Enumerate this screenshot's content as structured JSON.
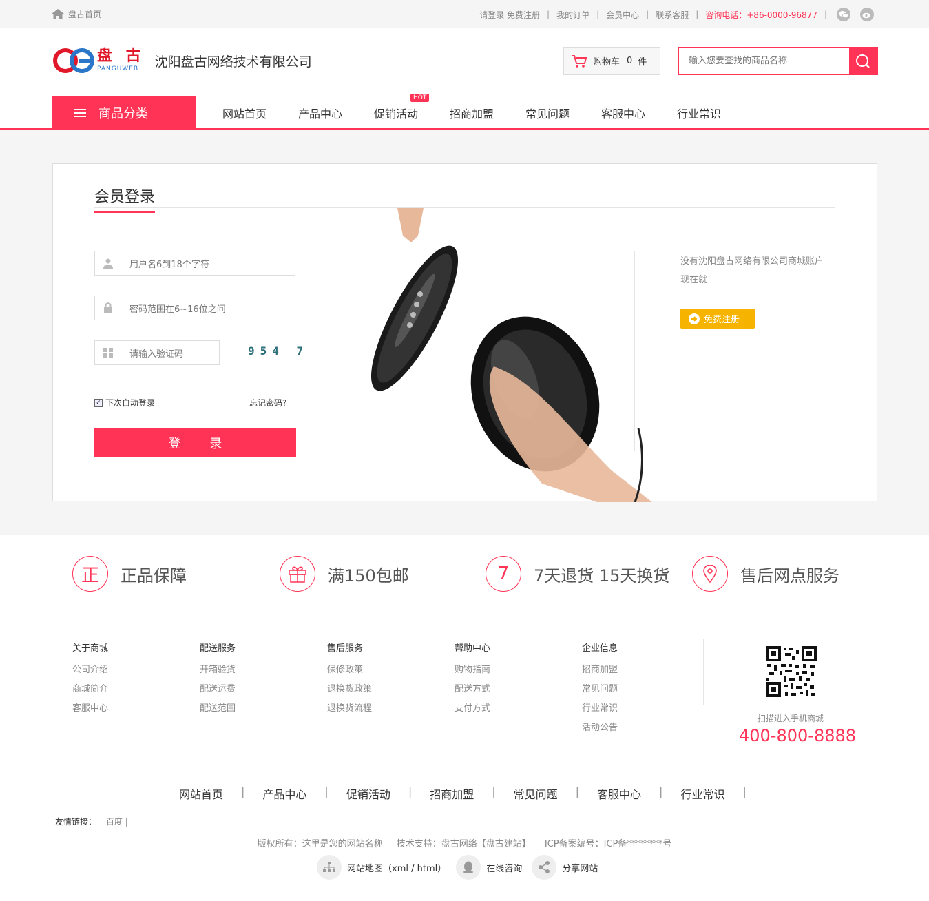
{
  "topbar": {
    "home_label": "盘古首页",
    "login_register": "请登录 免费注册",
    "my_orders": "我的订单",
    "member_center": "会员中心",
    "contact_service": "联系客服",
    "phone": "咨询电话：+86-0000-96877",
    "separator": "|"
  },
  "header": {
    "logo_cn": "盘 古",
    "logo_en": "PANGUWEB",
    "company_name": "沈阳盘古网络技术有限公司",
    "cart_label": "购物车",
    "cart_count": "0",
    "cart_unit": "件",
    "search_placeholder": "输入您要查找的商品名称"
  },
  "nav": {
    "category_label": "商品分类",
    "items": [
      {
        "label": "网站首页"
      },
      {
        "label": "产品中心"
      },
      {
        "label": "促销活动",
        "badge": "HOT"
      },
      {
        "label": "招商加盟"
      },
      {
        "label": "常见问题"
      },
      {
        "label": "客服中心"
      },
      {
        "label": "行业常识"
      }
    ]
  },
  "login": {
    "title": "会员登录",
    "username_placeholder": "用户名6到18个字符",
    "password_placeholder": "密码范围在6~16位之间",
    "captcha_placeholder": "请输入验证码",
    "captcha_code": "954 7",
    "remember_label": "下次自动登录",
    "forgot_label": "忘记密码?",
    "submit_label": "登 录"
  },
  "register": {
    "line1": "没有沈阳盘古网络有限公司商城账户",
    "line2": "现在就",
    "button_label": "免费注册"
  },
  "features": [
    {
      "icon_text": "正",
      "label": "正品保障"
    },
    {
      "icon_text": "",
      "label": "满150包邮"
    },
    {
      "icon_text": "7",
      "label": "7天退货 15天换货"
    },
    {
      "icon_text": "",
      "label": "售后网点服务"
    }
  ],
  "footer": {
    "columns": [
      {
        "title": "关于商城",
        "links": [
          "公司介绍",
          "商城简介",
          "客服中心"
        ]
      },
      {
        "title": "配送服务",
        "links": [
          "开箱验货",
          "配送运费",
          "配送范围"
        ]
      },
      {
        "title": "售后服务",
        "links": [
          "保修政策",
          "退换货政策",
          "退换货流程"
        ]
      },
      {
        "title": "帮助中心",
        "links": [
          "购物指南",
          "配送方式",
          "支付方式"
        ]
      },
      {
        "title": "企业信息",
        "links": [
          "招商加盟",
          "常见问题",
          "行业常识",
          "活动公告"
        ]
      }
    ],
    "qr_text": "扫描进入手机商城",
    "hotline": "400-800-8888",
    "bottom_nav": [
      "网站首页",
      "产品中心",
      "促销活动",
      "招商加盟",
      "常见问题",
      "客服中心",
      "行业常识"
    ],
    "friend_links_label": "友情链接：",
    "friend_links": [
      "百度"
    ],
    "copyright": "版权所有：这里是您的网站名称",
    "tech_support": "技术支持：盘古网络【盘古建站】",
    "icp": "ICP备案编号：ICP备********号",
    "tools": [
      "网站地图（xml / html）",
      "在线咨询",
      "分享网站"
    ]
  },
  "colors": {
    "accent": "#ff3355",
    "register_button": "#f6b400"
  }
}
